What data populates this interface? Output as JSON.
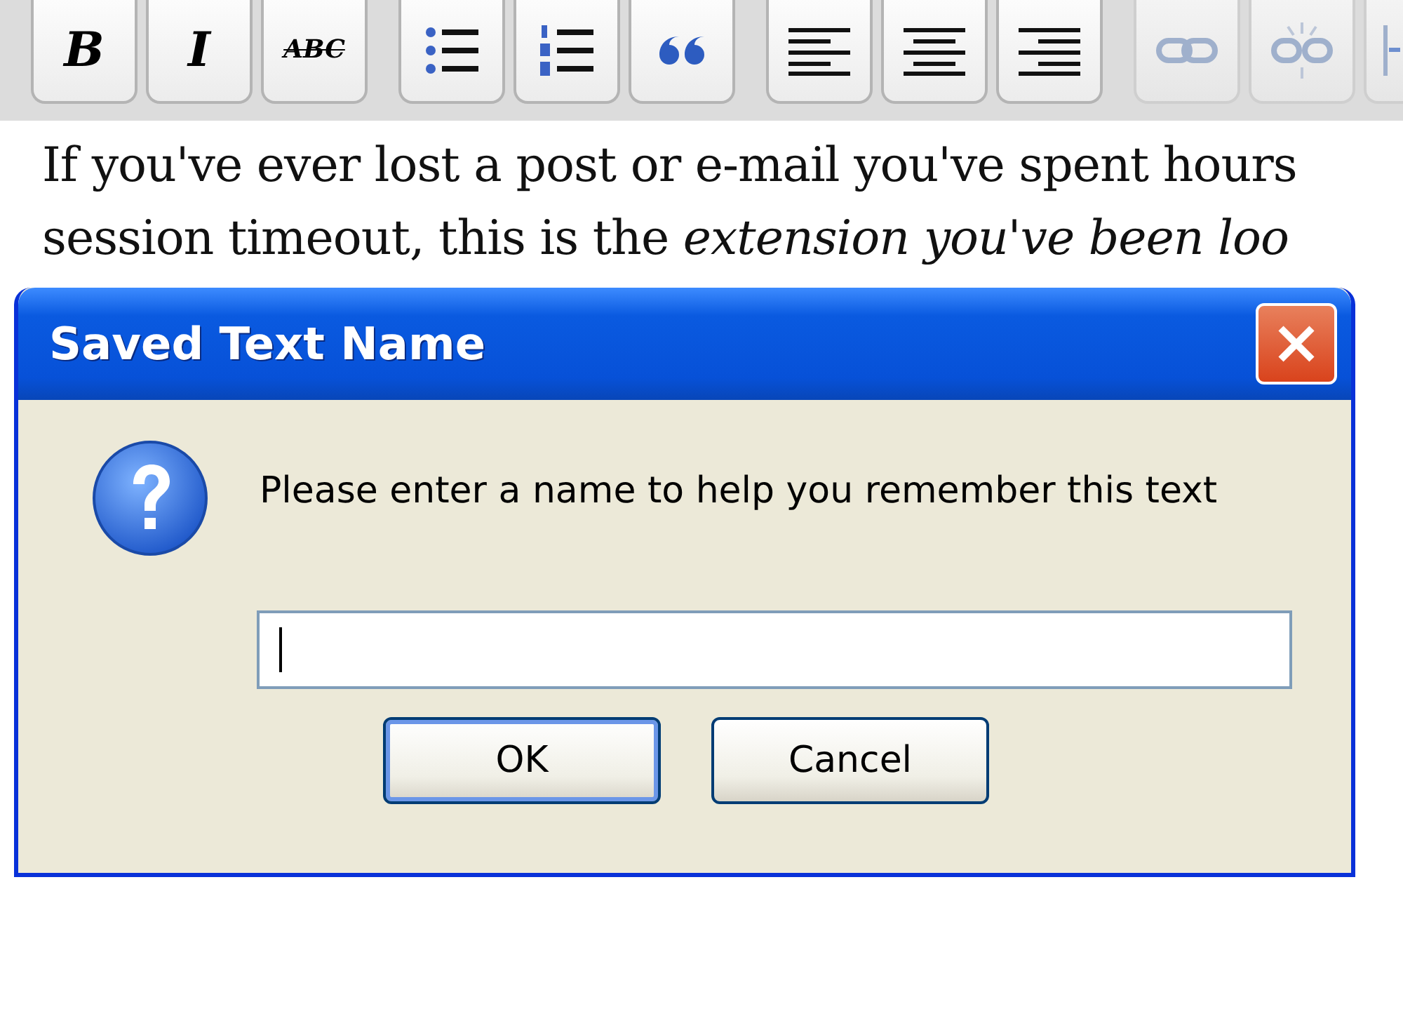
{
  "toolbar": {
    "groups": [
      {
        "buttons": [
          {
            "kind": "bold",
            "label": "B",
            "disabled": false
          },
          {
            "kind": "italic",
            "label": "I",
            "disabled": false
          },
          {
            "kind": "strike",
            "label": "ABC",
            "disabled": false
          }
        ]
      },
      {
        "buttons": [
          {
            "kind": "bullets",
            "disabled": false
          },
          {
            "kind": "numbers",
            "disabled": false
          },
          {
            "kind": "quote",
            "disabled": false
          }
        ]
      },
      {
        "buttons": [
          {
            "kind": "align-left",
            "disabled": false
          },
          {
            "kind": "align-center",
            "disabled": false
          },
          {
            "kind": "align-right",
            "disabled": false
          }
        ]
      },
      {
        "buttons": [
          {
            "kind": "link",
            "disabled": true
          },
          {
            "kind": "unlink",
            "disabled": true
          },
          {
            "kind": "more",
            "disabled": true
          }
        ]
      }
    ]
  },
  "editor": {
    "lines": [
      "If you've ever lost a post or e-mail you've spent hours",
      "session timeout, this is the *extension you've been loo*"
    ]
  },
  "dialog": {
    "title": "Saved Text Name",
    "message": "Please enter a name to help you remember this text",
    "buttons": [
      {
        "label": "OK",
        "default": true
      },
      {
        "label": "Cancel",
        "default": false
      }
    ]
  }
}
